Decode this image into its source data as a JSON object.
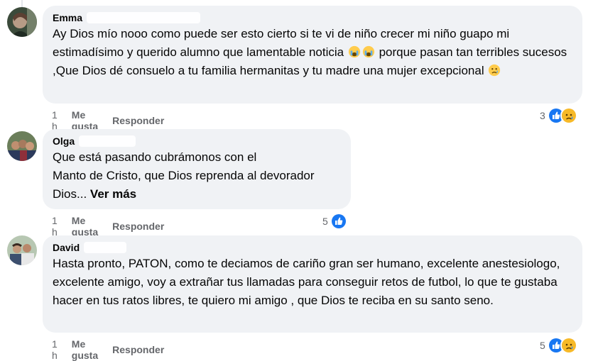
{
  "comments": [
    {
      "author": "Emma",
      "text_parts": [
        "Ay Dios mío nooo como puede ser esto cierto si te vi de niño crecer mi niño guapo mi estimadísimo y querido alumno que lamentable noticia ",
        " porque pasan tan terribles sucesos ,Que Dios dé consuelo a tu familia hermanitas y tu madre una mujer excepcional "
      ],
      "time": "1 h",
      "like_label": "Me gusta",
      "reply_label": "Responder",
      "reaction_count": "3",
      "reactions": [
        "like-icon",
        "sad-icon"
      ]
    },
    {
      "author": "Olga",
      "text_lines": [
        "Que está pasando cubrámonos con el",
        "Manto de Cristo, que Dios reprenda al devorador",
        "Dios..."
      ],
      "see_more": "Ver más",
      "time": "1 h",
      "like_label": "Me gusta",
      "reply_label": "Responder",
      "reaction_count": "5",
      "reactions": [
        "like-icon"
      ]
    },
    {
      "author": "David",
      "text": "Hasta pronto, PATON, como te deciamos de cariño gran ser humano, excelente anestesiologo, excelente amigo, voy a extrañar tus llamadas para conseguir retos de futbol, lo que te gustaba hacer en tus ratos libres, te quiero mi amigo , que Dios te reciba en su santo seno.",
      "time": "1 h",
      "like_label": "Me gusta",
      "reply_label": "Responder",
      "reaction_count": "5",
      "reactions": [
        "like-icon",
        "sad-icon"
      ]
    }
  ],
  "colors": {
    "bubble": "#f0f2f5",
    "like_blue": "#1877f2",
    "sad_yellow": "#f7b928",
    "meta_gray": "#65676b"
  }
}
